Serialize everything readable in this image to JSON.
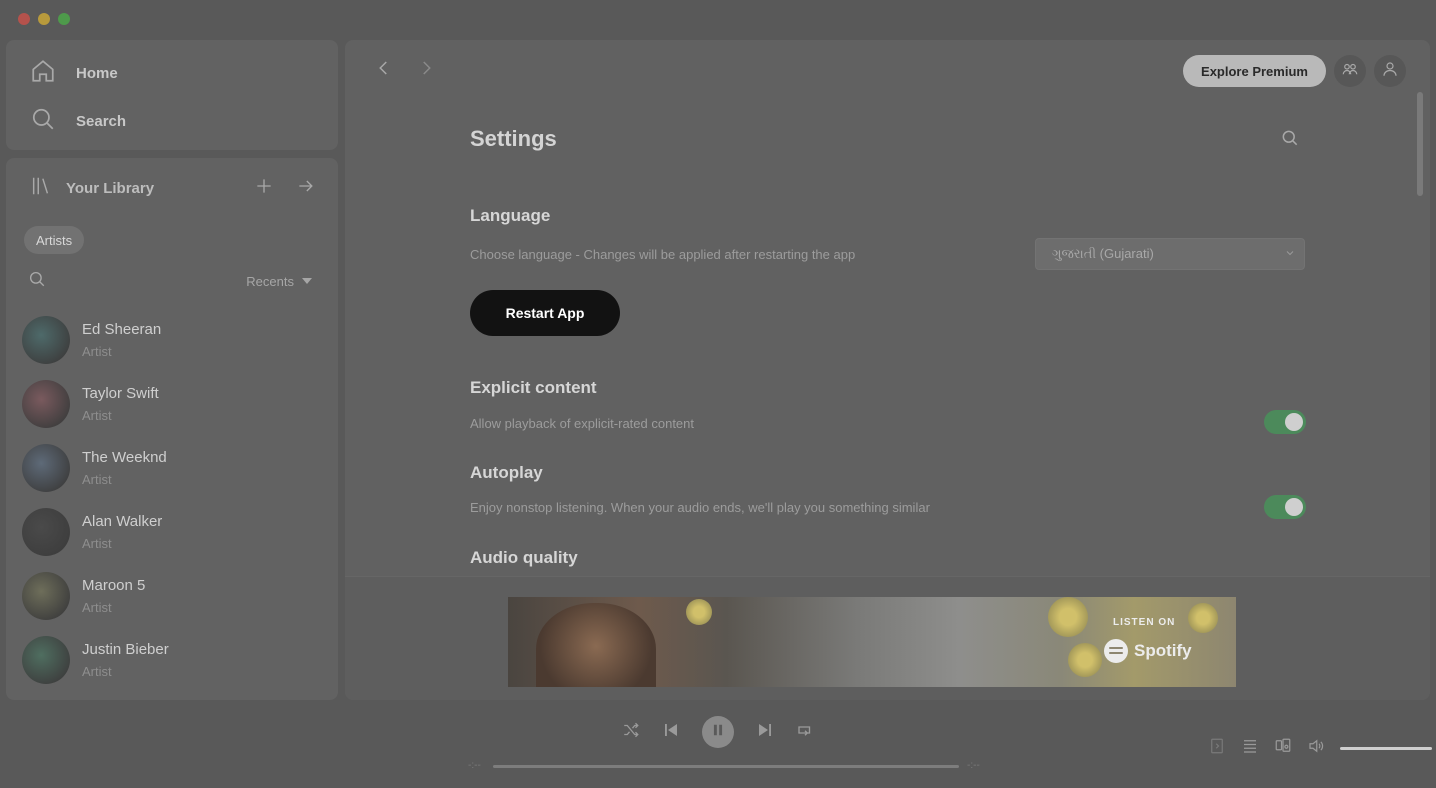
{
  "sidebar": {
    "nav": {
      "home": "Home",
      "search": "Search"
    },
    "library": {
      "title": "Your Library",
      "filter_chip": "Artists",
      "sort_label": "Recents",
      "artists": [
        {
          "name": "Ed Sheeran",
          "type": "Artist",
          "color": "#4e6a6a"
        },
        {
          "name": "Taylor Swift",
          "type": "Artist",
          "color": "#7a5a5e"
        },
        {
          "name": "The Weeknd",
          "type": "Artist",
          "color": "#5e6a78"
        },
        {
          "name": "Alan Walker",
          "type": "Artist",
          "color": "#4a4a4a"
        },
        {
          "name": "Maroon 5",
          "type": "Artist",
          "color": "#6e6e5a"
        },
        {
          "name": "Justin Bieber",
          "type": "Artist",
          "color": "#4f6e60"
        }
      ]
    }
  },
  "topbar": {
    "premium_label": "Explore Premium"
  },
  "settings": {
    "title": "Settings",
    "language": {
      "title": "Language",
      "description": "Choose language - Changes will be applied after restarting the app",
      "selected": "ગુજરાતી (Gujarati)",
      "restart_label": "Restart App"
    },
    "explicit": {
      "title": "Explicit content",
      "description": "Allow playback of explicit-rated content",
      "enabled": true
    },
    "autoplay": {
      "title": "Autoplay",
      "description": "Enjoy nonstop listening. When your audio ends, we'll play you something similar",
      "enabled": true
    },
    "audio_quality": {
      "title": "Audio quality"
    }
  },
  "ad": {
    "listen_on": "LISTEN ON",
    "brand": "Spotify"
  },
  "player": {
    "time_elapsed": "-:--",
    "time_total": "-:--"
  },
  "colors": {
    "toggle_on": "#4c8a5b",
    "restart_bg": "#121212"
  }
}
